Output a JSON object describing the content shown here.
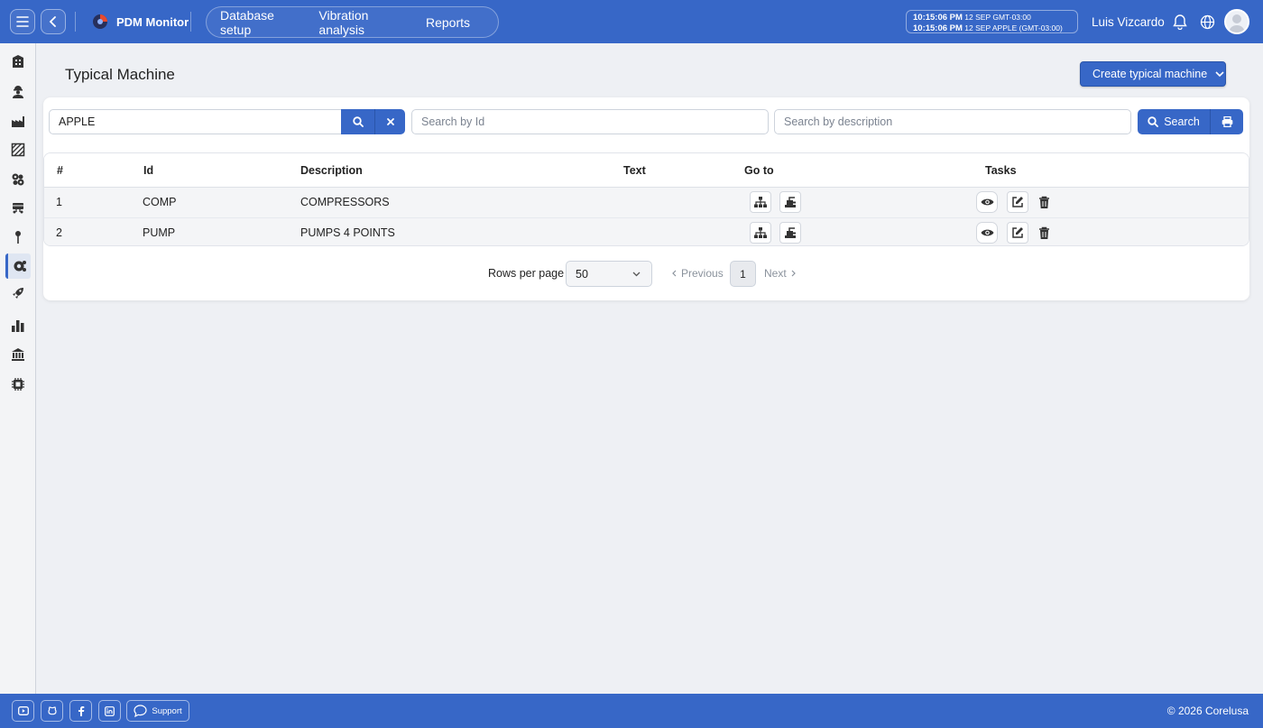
{
  "app": {
    "title": "PDM Monitor"
  },
  "nav": {
    "tabs": [
      {
        "label": "Database setup"
      },
      {
        "label": "Vibration analysis"
      },
      {
        "label": "Reports"
      }
    ]
  },
  "clock": {
    "time1": "10:15:06 PM",
    "zone1": "12 SEP  GMT-03:00",
    "time2": "10:15:06 PM",
    "zone2": "12 SEP  APPLE (GMT-03:00)"
  },
  "user": {
    "name": "Luis Vizcardo"
  },
  "sidebar": {
    "items": [
      {
        "icon": "building-icon"
      },
      {
        "icon": "worker-icon"
      },
      {
        "icon": "factory-icon"
      },
      {
        "icon": "area-icon"
      },
      {
        "icon": "gears-icon"
      },
      {
        "icon": "conveyor-icon"
      },
      {
        "icon": "pin-icon"
      },
      {
        "icon": "typical-machine-icon",
        "active": true
      },
      {
        "icon": "rocket-icon"
      },
      {
        "icon": "bar-chart-icon"
      },
      {
        "icon": "bank-icon"
      },
      {
        "icon": "chip-icon"
      }
    ]
  },
  "page": {
    "title": "Typical Machine",
    "create_label": "Create typical machine"
  },
  "filters": {
    "company_value": "APPLE",
    "id_placeholder": "Search by Id",
    "desc_placeholder": "Search by description",
    "search_label": "Search"
  },
  "table": {
    "headers": {
      "num": "#",
      "id": "Id",
      "description": "Description",
      "text": "Text",
      "goto": "Go to",
      "tasks": "Tasks"
    },
    "rows": [
      {
        "num": "1",
        "id": "COMP",
        "description": "COMPRESSORS",
        "text": ""
      },
      {
        "num": "2",
        "id": "PUMP",
        "description": "PUMPS 4 POINTS",
        "text": ""
      }
    ]
  },
  "pagination": {
    "rows_per_page_label": "Rows per page",
    "rows_per_page": "50",
    "previous": "Previous",
    "page": "1",
    "next": "Next"
  },
  "footer": {
    "support": "Support",
    "copyright": "© 2026 Corelusa"
  },
  "colors": {
    "primary": "#3767c7",
    "background": "#eef0f4"
  }
}
